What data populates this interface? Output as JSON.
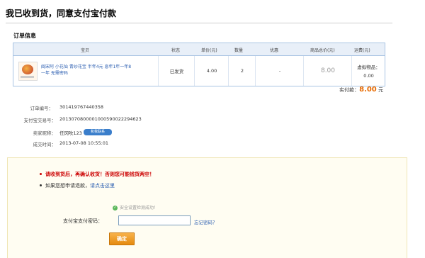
{
  "page": {
    "title": "我已收到货，同意支付宝付款",
    "section_title": "订单信息"
  },
  "table": {
    "headers": [
      "宝贝",
      "状态",
      "单价(元)",
      "数量",
      "优惠",
      "商品总价(元)",
      "运费(元)"
    ],
    "row": {
      "product_name": "闽宋阿 小花仙 青纱花宝 半年4元 息年1年一年8一年 无需密码",
      "status": "已发货",
      "unit_price": "4.00",
      "quantity": "2",
      "discount": "-",
      "total": "8.00",
      "shipping_label": "虚拟物品：",
      "shipping_value": "0.00"
    }
  },
  "payment": {
    "label": "实付款：",
    "amount": "8.00",
    "unit": "元"
  },
  "info": {
    "order_no_label": "订单编号：",
    "order_no": "301419767440358",
    "trade_no_label": "支付宝交易号：",
    "trade_no": "2013070800001000590022294623",
    "seller_label": "卖家昵称：",
    "seller": "任冈吹123",
    "contact": "和我联系",
    "time_label": "成交时间：",
    "time": "2013-07-08 10:55:01"
  },
  "confirm": {
    "warning": "请收到货后，再确认收货！否则您可能钱货两空！",
    "refund_text": "如果您想申请退款，",
    "refund_link": "请点击这里",
    "safe_text": "安全设置检测成功！",
    "password_label": "支付宝支付密码：",
    "forgot_link": "忘记密码？",
    "confirm_button": "确定"
  },
  "colors": {
    "accent": "#e86a00",
    "link": "#2a5db0",
    "warning": "#cc0000",
    "table_header": "#e8eff8"
  }
}
